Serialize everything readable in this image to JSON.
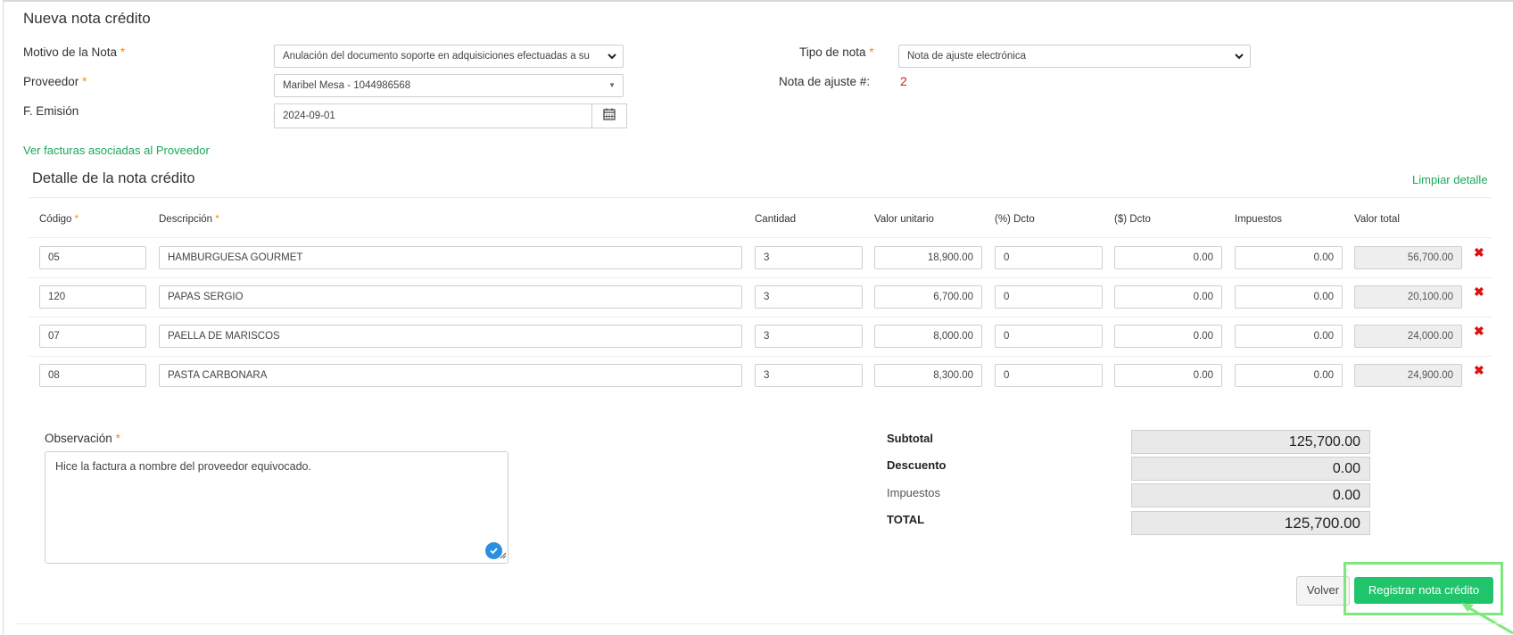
{
  "page": {
    "title": "Nueva nota crédito"
  },
  "form": {
    "motivo_label": "Motivo de la Nota",
    "motivo_value": "Anulación del documento soporte en adquisiciones efectuadas a su",
    "proveedor_label": "Proveedor",
    "proveedor_value": "Maribel Mesa - 1044986568",
    "emision_label": "F. Emisión",
    "emision_value": "2024-09-01",
    "tipo_label": "Tipo de nota",
    "tipo_value": "Nota de ajuste electrónica",
    "ajuste_label": "Nota de ajuste #:",
    "ajuste_value": "2",
    "required_mark": "*"
  },
  "links": {
    "ver_facturas": "Ver facturas asociadas al Proveedor",
    "limpiar": "Limpiar detalle"
  },
  "detail": {
    "title": "Detalle de la nota crédito",
    "headers": [
      "Código",
      "Descripción",
      "Cantidad",
      "Valor unitario",
      "(%) Dcto",
      "($) Dcto",
      "Impuestos",
      "Valor total"
    ],
    "rows": [
      {
        "codigo": "05",
        "descripcion": "HAMBURGUESA GOURMET",
        "cantidad": "3",
        "valor_unitario": "18,900.00",
        "pct_dcto": "0",
        "dcto": "0.00",
        "impuestos": "0.00",
        "total": "56,700.00"
      },
      {
        "codigo": "120",
        "descripcion": "PAPAS SERGIO",
        "cantidad": "3",
        "valor_unitario": "6,700.00",
        "pct_dcto": "0",
        "dcto": "0.00",
        "impuestos": "0.00",
        "total": "20,100.00"
      },
      {
        "codigo": "07",
        "descripcion": "PAELLA DE MARISCOS",
        "cantidad": "3",
        "valor_unitario": "8,000.00",
        "pct_dcto": "0",
        "dcto": "0.00",
        "impuestos": "0.00",
        "total": "24,000.00"
      },
      {
        "codigo": "08",
        "descripcion": "PASTA CARBONARA",
        "cantidad": "3",
        "valor_unitario": "8,300.00",
        "pct_dcto": "0",
        "dcto": "0.00",
        "impuestos": "0.00",
        "total": "24,900.00"
      }
    ],
    "delete_glyph": "✖"
  },
  "observacion": {
    "label": "Observación",
    "value": "Hice la factura a nombre del proveedor equivocado."
  },
  "totals": {
    "subtotal_label": "Subtotal",
    "subtotal_value": "125,700.00",
    "descuento_label": "Descuento",
    "descuento_value": "0.00",
    "impuestos_label": "Impuestos",
    "impuestos_value": "0.00",
    "total_label": "TOTAL",
    "total_value": "125,700.00"
  },
  "buttons": {
    "volver": "Volver",
    "registrar": "Registrar nota crédito"
  },
  "colors": {
    "accent_green": "#20c46b",
    "link_green": "#1aa85a",
    "required": "#ff8a00",
    "delete_red": "#e01010",
    "ajuste_number": "#d42020"
  }
}
